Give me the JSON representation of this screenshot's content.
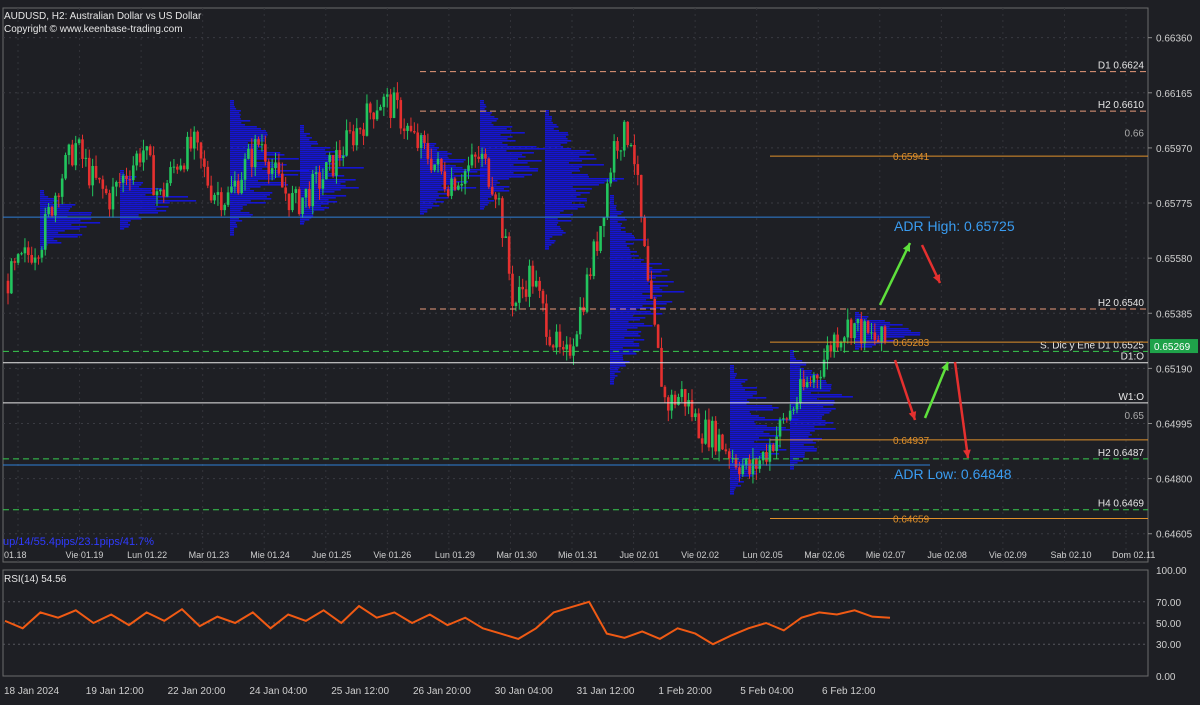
{
  "header": {
    "title": "AUDUSD, H2:  Australian Dollar vs US Dollar",
    "copyright": "Copyright © www.keenbase-trading.com"
  },
  "stats_text": "up/14/55.4pips/23.1pips/41.7%",
  "rsi_title": "RSI(14) 54.56",
  "colors": {
    "background": "#1e1f24",
    "bull_candle": "#22c55e",
    "bear_candle": "#e5302f",
    "volume_profile": "#1414e6",
    "orange_level": "#e0902a",
    "salmon_level": "#e89a7a",
    "green_dashed": "#37c94e",
    "blue_level": "#2f7fd6",
    "white_level": "#e8e8e8",
    "adr_text": "#3a9cf0",
    "rsi_line": "#f05a14",
    "current_price_box": "#1fa24a"
  },
  "chart_data": {
    "type": "candlestick",
    "symbol": "AUDUSD",
    "timeframe": "H2",
    "price_axis": {
      "ylim": [
        0.64505,
        0.66465
      ],
      "ticks": [
        "0.66360",
        "0.66165",
        "0.65970",
        "0.65775",
        "0.65580",
        "0.65385",
        "0.65190",
        "0.64995",
        "0.64800",
        "0.64605"
      ]
    },
    "price_path": [
      0.655,
      0.6558,
      0.6565,
      0.6585,
      0.6598,
      0.6586,
      0.6579,
      0.6588,
      0.6597,
      0.6579,
      0.6592,
      0.6598,
      0.6583,
      0.6579,
      0.659,
      0.66,
      0.6585,
      0.6577,
      0.6582,
      0.6589,
      0.6598,
      0.6606,
      0.6614,
      0.6611,
      0.66,
      0.6594,
      0.6585,
      0.6588,
      0.6594,
      0.6582,
      0.6541,
      0.6553,
      0.6534,
      0.652,
      0.6541,
      0.6566,
      0.66,
      0.6602,
      0.6544,
      0.6506,
      0.651,
      0.6498,
      0.6495,
      0.6488,
      0.6482,
      0.649,
      0.65,
      0.651,
      0.6518,
      0.653,
      0.6535,
      0.653,
      0.6528
    ],
    "levels": [
      {
        "label": "D1 0.6624",
        "value": 0.6624,
        "style": "salmon-dashed"
      },
      {
        "label": "H2 0.6610",
        "value": 0.661,
        "style": "salmon-dashed"
      },
      {
        "label": "0.66",
        "value": 0.66,
        "style": "tick"
      },
      {
        "label": "0.65941",
        "value": 0.65941,
        "style": "orange"
      },
      {
        "label": "H2 0.6540",
        "value": 0.654,
        "style": "salmon-dashed"
      },
      {
        "label": "S. Dic y Ene D1 0.6525",
        "value": 0.6525,
        "style": "green-dashed"
      },
      {
        "label": "0.65283",
        "value": 0.65283,
        "style": "orange"
      },
      {
        "label": "D1:O",
        "value": 0.6521,
        "style": "white"
      },
      {
        "label": "W1:O",
        "value": 0.65068,
        "style": "white"
      },
      {
        "label": "0.65",
        "value": 0.65,
        "style": "tick"
      },
      {
        "label": "0.64937",
        "value": 0.64937,
        "style": "orange"
      },
      {
        "label": "H2 0.6487",
        "value": 0.6487,
        "style": "green-dashed"
      },
      {
        "label": "H4 0.6469",
        "value": 0.6469,
        "style": "green-dashed"
      },
      {
        "label": "0.64659",
        "value": 0.64659,
        "style": "orange"
      }
    ],
    "blue_levels": [
      0.65725,
      0.64848
    ],
    "current_price": "0.65269",
    "current_price_value": 0.65269,
    "adr_high": {
      "label": "ADR High: 0.65725",
      "value": 0.65725
    },
    "adr_low": {
      "label": "ADR Low: 0.64848",
      "value": 0.64848
    },
    "session_axis": [
      "01.18",
      "Vie 01.19",
      "Lun 01.22",
      "Mar 01.23",
      "Mie 01.24",
      "Jue 01.25",
      "Vie 01.26",
      "Lun 01.29",
      "Mar 01.30",
      "Mie 01.31",
      "Jue 02.01",
      "Vie 02.02",
      "Lun 02.05",
      "Mar 02.06",
      "Mie 02.07",
      "Jue 02.08",
      "Vie 02.09",
      "Sab 02.10",
      "Dom 02.11"
    ],
    "date_axis": [
      "18 Jan 2024",
      "19 Jan 12:00",
      "22 Jan 20:00",
      "24 Jan 04:00",
      "25 Jan 12:00",
      "26 Jan 20:00",
      "30 Jan 04:00",
      "31 Jan 12:00",
      "1 Feb 20:00",
      "5 Feb 04:00",
      "6 Feb 12:00"
    ],
    "rsi": {
      "label": "RSI(14) 54.56",
      "period": 14,
      "value": 54.56,
      "ylim": [
        0,
        100
      ],
      "ticks": [
        "100.00",
        "70.00",
        "50.00",
        "30.00",
        "0.00"
      ],
      "path": [
        52,
        45,
        60,
        55,
        62,
        50,
        58,
        48,
        60,
        52,
        63,
        47,
        56,
        50,
        60,
        45,
        58,
        52,
        62,
        50,
        66,
        55,
        60,
        50,
        58,
        48,
        55,
        45,
        40,
        35,
        45,
        60,
        65,
        70,
        40,
        36,
        42,
        35,
        45,
        40,
        30,
        38,
        45,
        50,
        43,
        55,
        60,
        58,
        62,
        56,
        55
      ]
    }
  }
}
